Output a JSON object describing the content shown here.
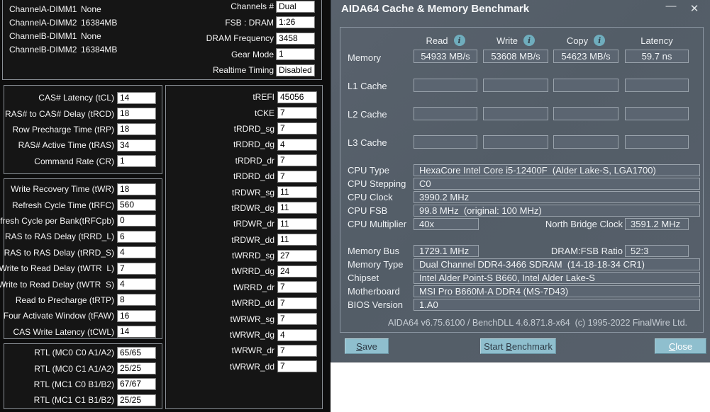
{
  "left_panel": {
    "dimm_rows": [
      {
        "label": "ChannelA-DIMM1",
        "value": "None"
      },
      {
        "label": "ChannelA-DIMM2",
        "value": "16384MB"
      },
      {
        "label": "ChannelB-DIMM1",
        "value": "None"
      },
      {
        "label": "ChannelB-DIMM2",
        "value": "16384MB"
      }
    ],
    "config_rows": [
      {
        "label": "Channels #",
        "value": "Dual"
      },
      {
        "label": "FSB : DRAM",
        "value": "1:26"
      },
      {
        "label": "DRAM Frequency",
        "value": "3458"
      },
      {
        "label": "Gear Mode",
        "value": "1"
      },
      {
        "label": "Realtime Timing",
        "value": "Disabled"
      }
    ],
    "primary_timings": [
      {
        "label": "CAS# Latency (tCL)",
        "value": "14"
      },
      {
        "label": "RAS# to CAS# Delay (tRCD)",
        "value": "18"
      },
      {
        "label": "Row Precharge Time (tRP)",
        "value": "18"
      },
      {
        "label": "RAS# Active Time (tRAS)",
        "value": "34"
      },
      {
        "label": "Command Rate (CR)",
        "value": "1"
      }
    ],
    "secondary_timings": [
      {
        "label": "Write Recovery Time (tWR)",
        "value": "18"
      },
      {
        "label": "Refresh Cycle Time (tRFC)",
        "value": "560"
      },
      {
        "label": "Refresh Cycle per Bank(tRFCpb)",
        "value": "0"
      },
      {
        "label": "RAS to RAS Delay (tRRD_L)",
        "value": "6"
      },
      {
        "label": "RAS to RAS Delay (tRRD_S)",
        "value": "4"
      },
      {
        "label": "Write to Read Delay (tWTR  L)",
        "value": "7"
      },
      {
        "label": "Write to Read Delay (tWTR  S)",
        "value": "4"
      },
      {
        "label": "Read to Precharge (tRTP)",
        "value": "8"
      },
      {
        "label": "Four Activate Window (tFAW)",
        "value": "16"
      },
      {
        "label": "CAS Write Latency (tCWL)",
        "value": "14"
      }
    ],
    "rtl_rows": [
      {
        "label": "RTL (MC0 C0 A1/A2)",
        "value": "65/65"
      },
      {
        "label": "RTL (MC0 C1 A1/A2)",
        "value": "25/25"
      },
      {
        "label": "RTL (MC1 C0 B1/B2)",
        "value": "67/67"
      },
      {
        "label": "RTL (MC1 C1 B1/B2)",
        "value": "25/25"
      }
    ],
    "tertiary_timings": [
      {
        "label": "tREFI",
        "value": "45056"
      },
      {
        "label": "tCKE",
        "value": "7"
      },
      {
        "label": "tRDRD_sg",
        "value": "7"
      },
      {
        "label": "tRDRD_dg",
        "value": "4"
      },
      {
        "label": "tRDRD_dr",
        "value": "7"
      },
      {
        "label": "tRDRD_dd",
        "value": "7"
      },
      {
        "label": "tRDWR_sg",
        "value": "11"
      },
      {
        "label": "tRDWR_dg",
        "value": "11"
      },
      {
        "label": "tRDWR_dr",
        "value": "11"
      },
      {
        "label": "tRDWR_dd",
        "value": "11"
      },
      {
        "label": "tWRRD_sg",
        "value": "27"
      },
      {
        "label": "tWRRD_dg",
        "value": "24"
      },
      {
        "label": "tWRRD_dr",
        "value": "7"
      },
      {
        "label": "tWRRD_dd",
        "value": "7"
      },
      {
        "label": "tWRWR_sg",
        "value": "7"
      },
      {
        "label": "tWRWR_dg",
        "value": "4"
      },
      {
        "label": "tWRWR_dr",
        "value": "7"
      },
      {
        "label": "tWRWR_dd",
        "value": "7"
      }
    ]
  },
  "benchmark": {
    "title": "AIDA64 Cache & Memory Benchmark",
    "window_controls": {
      "minimize": "—",
      "close": "✕"
    },
    "info_glyph": "i",
    "columns": [
      "Read",
      "Write",
      "Copy",
      "Latency"
    ],
    "memory_row": {
      "label": "Memory",
      "values": [
        "54933 MB/s",
        "53608 MB/s",
        "54623 MB/s",
        "59.7 ns"
      ]
    },
    "cache_rows": [
      {
        "label": "L1 Cache"
      },
      {
        "label": "L2 Cache"
      },
      {
        "label": "L3 Cache"
      }
    ],
    "cpu_rows": [
      {
        "label": "CPU Type",
        "value": "HexaCore Intel Core i5-12400F  (Alder Lake-S, LGA1700)"
      },
      {
        "label": "CPU Stepping",
        "value": "C0"
      },
      {
        "label": "CPU Clock",
        "value": "3990.2 MHz"
      },
      {
        "label": "CPU FSB",
        "value": "99.8 MHz  (original: 100 MHz)"
      }
    ],
    "cpu_multiplier_row": {
      "label": "CPU Multiplier",
      "value": "40x",
      "right_label": "North Bridge Clock",
      "right_value": "3591.2 MHz"
    },
    "memory_bus_row": {
      "label": "Memory Bus",
      "value": "1729.1 MHz",
      "right_label": "DRAM:FSB Ratio",
      "right_value": "52:3"
    },
    "board_rows": [
      {
        "label": "Memory Type",
        "value": "Dual Channel DDR4-3466 SDRAM  (14-18-18-34 CR1)"
      },
      {
        "label": "Chipset",
        "value": "Intel Alder Point-S B660, Intel Alder Lake-S"
      },
      {
        "label": "Motherboard",
        "value": "MSI Pro B660M-A DDR4 (MS-7D43)"
      },
      {
        "label": "BIOS Version",
        "value": "1.A0"
      }
    ],
    "footer": "AIDA64 v6.75.6100 / BenchDLL 4.6.871.8-x64  (c) 1995-2022 FinalWire Ltd.",
    "buttons": {
      "save": {
        "pre": "",
        "key": "S",
        "post": "ave"
      },
      "start": {
        "pre": "Start ",
        "key": "B",
        "post": "enchmark"
      },
      "close": {
        "pre": "",
        "key": "C",
        "post": "lose"
      }
    }
  },
  "colors": {
    "panel_bg": "#0d0d0d",
    "window_bg": "#565f6a",
    "button_accent": "#8fbfce",
    "info_icon": "#6fadbd",
    "value_box_border": "#9aa3ac"
  }
}
